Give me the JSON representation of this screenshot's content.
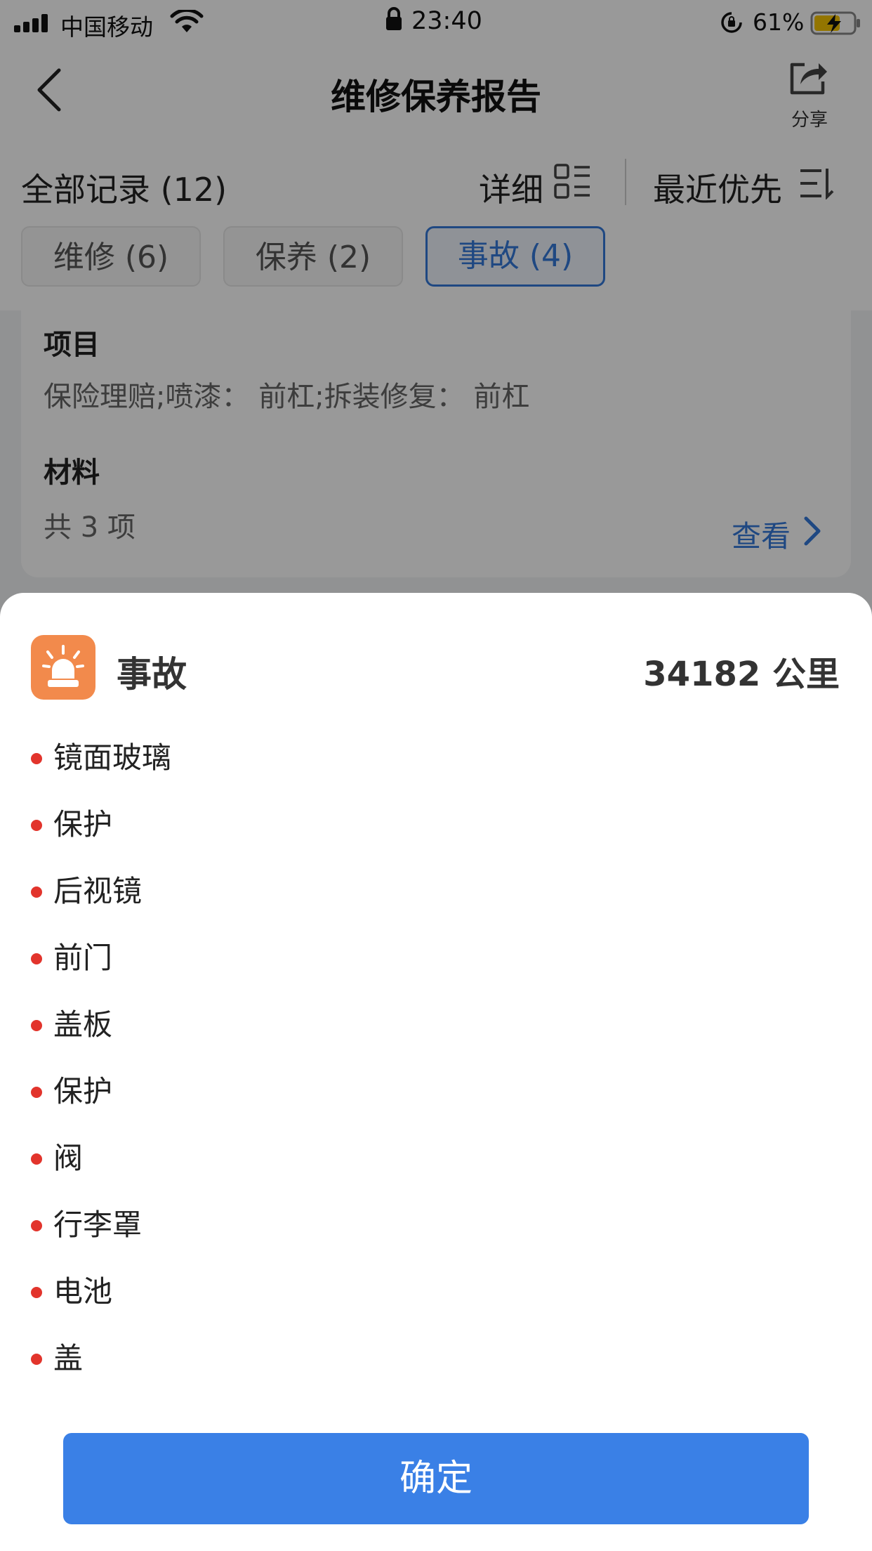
{
  "status_bar": {
    "carrier": "中国移动",
    "time": "23:40",
    "battery_percent": "61%"
  },
  "nav": {
    "title": "维修保养报告",
    "share_label": "分享"
  },
  "filters": {
    "all_records": "全部记录 (12)",
    "detail": "详细",
    "recent_first": "最近优先",
    "chips": [
      {
        "label": "维修 (6)",
        "active": false
      },
      {
        "label": "保养 (2)",
        "active": false
      },
      {
        "label": "事故 (4)",
        "active": true
      }
    ]
  },
  "card": {
    "item_label": "项目",
    "item_value": "保险理赔;喷漆：  前杠;拆装修复：  前杠",
    "material_label": "材料",
    "material_value": "共 3 项",
    "view_label": "查看"
  },
  "sheet": {
    "title": "事故",
    "mileage": "34182 公里",
    "items": [
      "镜面玻璃",
      "保护",
      "后视镜",
      "前门",
      "盖板",
      "保护",
      "阀",
      "行李罩",
      "电池",
      "盖"
    ],
    "confirm_label": "确定"
  },
  "colors": {
    "accent": "#3a80e6",
    "incident_icon_bg": "#f28a4c",
    "bullet": "#e2342c"
  }
}
